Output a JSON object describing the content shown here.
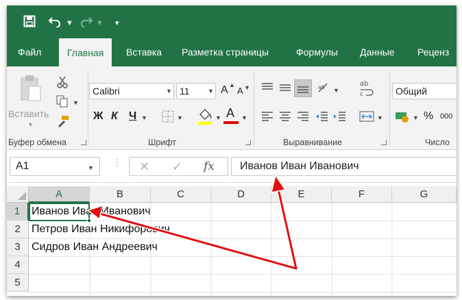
{
  "qat": {
    "save_icon": "floppy-disk-icon",
    "undo_icon": "undo-icon",
    "redo_icon": "redo-icon",
    "customize_icon": "customize-qat-icon"
  },
  "tabs": [
    "Файл",
    "Главная",
    "Вставка",
    "Разметка страницы",
    "Формулы",
    "Данные",
    "Реценз"
  ],
  "active_tab": "Главная",
  "clipboard": {
    "paste_label": "Вставить",
    "group_label": "Буфер обмена"
  },
  "font": {
    "name": "Calibri",
    "size": "11",
    "grow_label": "A",
    "shrink_label": "A",
    "bold": "Ж",
    "italic": "К",
    "underline": "Ч",
    "font_color_label": "A",
    "fill_color": "#ffff00",
    "font_color": "#e00000",
    "group_label": "Шрифт"
  },
  "alignment": {
    "group_label": "Выравнивание",
    "wrap_label": "ab c"
  },
  "number": {
    "format": "Общий",
    "percent": "%",
    "thousands": "000",
    "group_label": "Число"
  },
  "formula_bar": {
    "name_box": "A1",
    "cancel": "✕",
    "enter": "✓",
    "fx": "fx",
    "content": "Иванов Иван Иванович"
  },
  "grid": {
    "columns": [
      "A",
      "B",
      "C",
      "D",
      "E",
      "F",
      "G"
    ],
    "rows": [
      "1",
      "2",
      "3",
      "4",
      "5"
    ],
    "cells": {
      "A1": "Иванов Иван Иванович",
      "A2": "Петров Иван Никифорович",
      "A3": "Сидров Иван Андреевич"
    },
    "selected": "A1"
  },
  "annotation": {
    "arrow_color": "#e01010"
  },
  "colors": {
    "excel_green": "#217346",
    "ribbon_bg": "#f3f3f3"
  }
}
